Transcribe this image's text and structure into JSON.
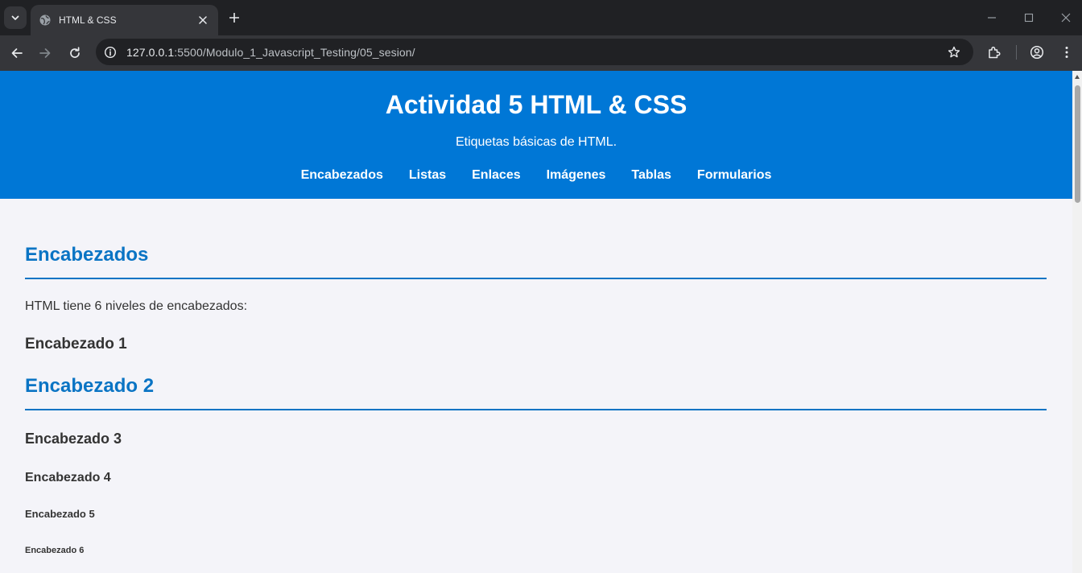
{
  "browser": {
    "tab_title": "HTML & CSS",
    "url_host": "127.0.0.1",
    "url_rest": ":5500/Modulo_1_Javascript_Testing/05_sesion/"
  },
  "header": {
    "title": "Actividad 5 HTML & CSS",
    "subtitle": "Etiquetas básicas de HTML.",
    "nav": [
      "Encabezados",
      "Listas",
      "Enlaces",
      "Imágenes",
      "Tablas",
      "Formularios"
    ]
  },
  "section": {
    "title": "Encabezados",
    "intro": "HTML tiene 6 niveles de encabezados:",
    "headings": [
      "Encabezado 1",
      "Encabezado 2",
      "Encabezado 3",
      "Encabezado 4",
      "Encabezado 5",
      "Encabezado 6"
    ]
  },
  "colors": {
    "header_bg": "#0077d6",
    "accent": "#0a74c4",
    "page_bg": "#f4f4f9",
    "text": "#333333"
  },
  "icons": [
    "tab-search-icon",
    "globe-icon",
    "close-icon",
    "plus-icon",
    "minimize-icon",
    "maximize-icon",
    "back-icon",
    "forward-icon",
    "reload-icon",
    "info-icon",
    "star-icon",
    "extensions-icon",
    "profile-icon",
    "menu-icon"
  ]
}
